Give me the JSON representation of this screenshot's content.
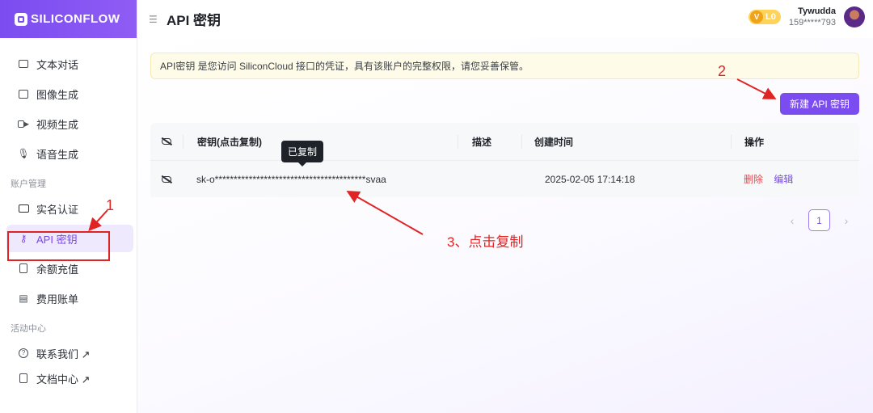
{
  "app": {
    "logo_text": "SILICONFLOW"
  },
  "sidebar": {
    "items": [
      {
        "label": "文本对话",
        "icon": "chat-icon"
      },
      {
        "label": "图像生成",
        "icon": "image-icon"
      },
      {
        "label": "视频生成",
        "icon": "video-icon"
      },
      {
        "label": "语音生成",
        "icon": "microphone-icon"
      }
    ],
    "group_account": "账户管理",
    "account_items": [
      {
        "label": "实名认证",
        "icon": "id-card-icon"
      },
      {
        "label": "API 密钥",
        "icon": "key-icon",
        "active": true
      },
      {
        "label": "余额充值",
        "icon": "wallet-icon"
      },
      {
        "label": "费用账单",
        "icon": "bill-icon"
      }
    ],
    "group_activity": "活动中心",
    "activity_items": [
      {
        "label": "联系我们 ↗",
        "icon": "help-icon"
      },
      {
        "label": "文档中心 ↗",
        "icon": "document-icon"
      }
    ]
  },
  "header": {
    "menu_icon": "menu-collapse-icon",
    "title": "API 密钥",
    "level": "L0",
    "level_mark": "V",
    "user_name": "Tywudda",
    "user_phone": "159*****793"
  },
  "main": {
    "notice": "API密钥 是您访问 SiliconCloud 接口的凭证，具有该账户的完整权限，请您妥善保管。",
    "new_button": "新建 API 密钥",
    "table": {
      "headers": {
        "key": "密钥(点击复制)",
        "desc": "描述",
        "time": "创建时间",
        "ops": "操作"
      },
      "rows": [
        {
          "key": "sk-o****************************************svaa",
          "desc": "",
          "time": "2025-02-05 17:14:18",
          "delete": "删除",
          "edit": "编辑"
        }
      ]
    },
    "tooltip": "已复制",
    "pagination": {
      "prev": "‹",
      "page": "1",
      "next": "›"
    }
  },
  "annotations": {
    "step1": "1",
    "step2": "2",
    "step3": "3、点击复制",
    "color": "#e02424"
  },
  "colors": {
    "brand": "#7b4cf0",
    "danger": "#e5484d",
    "notice_bg": "#fefbe8"
  }
}
